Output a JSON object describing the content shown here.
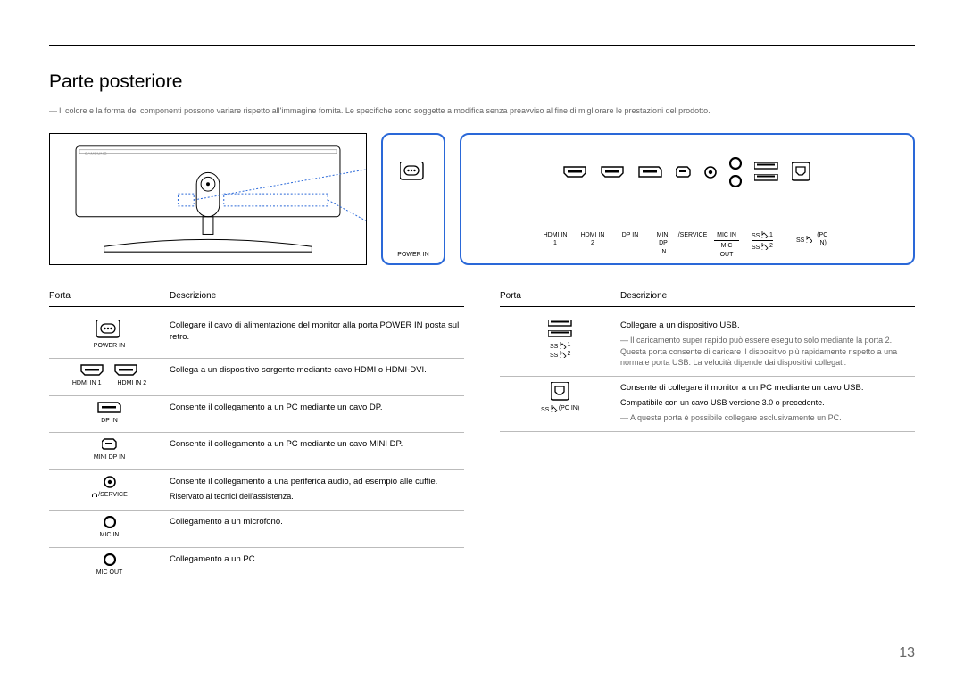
{
  "page_number": "13",
  "title": "Parte posteriore",
  "disclaimer": "Il colore e la forma dei componenti possono variare rispetto all'immagine fornita. Le specifiche sono soggette a modifica senza preavviso al fine di migliorare le prestazioni del prodotto.",
  "diagram_labels": {
    "power": "POWER IN",
    "hdmi1": "HDMI IN 1",
    "hdmi2": "HDMI IN 2",
    "dp": "DP IN",
    "minidp": "MINI DP IN",
    "service": "/SERVICE",
    "micin": "MIC IN",
    "micout": "MIC OUT",
    "ss1": "1",
    "ss2": "2",
    "pcin": "(PC IN)"
  },
  "left_table": {
    "headers": {
      "porta": "Porta",
      "desc": "Descrizione"
    },
    "rows": [
      {
        "label": "POWER IN",
        "desc": "Collegare il cavo di alimentazione del monitor alla porta POWER IN posta sul retro."
      },
      {
        "label_left": "HDMI IN 1",
        "label_right": "HDMI IN 2",
        "desc": "Collega a un dispositivo sorgente mediante cavo HDMI o HDMI-DVI."
      },
      {
        "label": "DP IN",
        "desc": "Consente il collegamento a un PC mediante un cavo DP."
      },
      {
        "label": "MINI DP IN",
        "desc": "Consente il collegamento a un PC mediante un cavo MINI DP."
      },
      {
        "label": "/SERVICE",
        "desc_main": "Consente il collegamento a una periferica audio, ad esempio alle cuffie.",
        "desc_sub": "Riservato ai tecnici dell'assistenza."
      },
      {
        "label": "MIC IN",
        "desc": "Collegamento a un microfono."
      },
      {
        "label": "MIC OUT",
        "desc": "Collegamento a un PC"
      }
    ]
  },
  "right_table": {
    "headers": {
      "porta": "Porta",
      "desc": "Descrizione"
    },
    "rows": [
      {
        "label_top": "1",
        "label_bottom": "2",
        "desc_main": "Collegare a un dispositivo USB.",
        "desc_sub": "Il caricamento super rapido può essere eseguito solo mediante la porta 2. Questa porta consente di caricare il dispositivo più rapidamente rispetto a una normale porta USB. La velocità dipende dai dispositivi collegati."
      },
      {
        "label": "(PC IN)",
        "desc_line1": "Consente di collegare il monitor a un PC mediante un cavo USB.",
        "desc_line2": "Compatibile con un cavo USB versione 3.0 o precedente.",
        "desc_sub": "A questa porta è possibile collegare esclusivamente un PC."
      }
    ]
  }
}
